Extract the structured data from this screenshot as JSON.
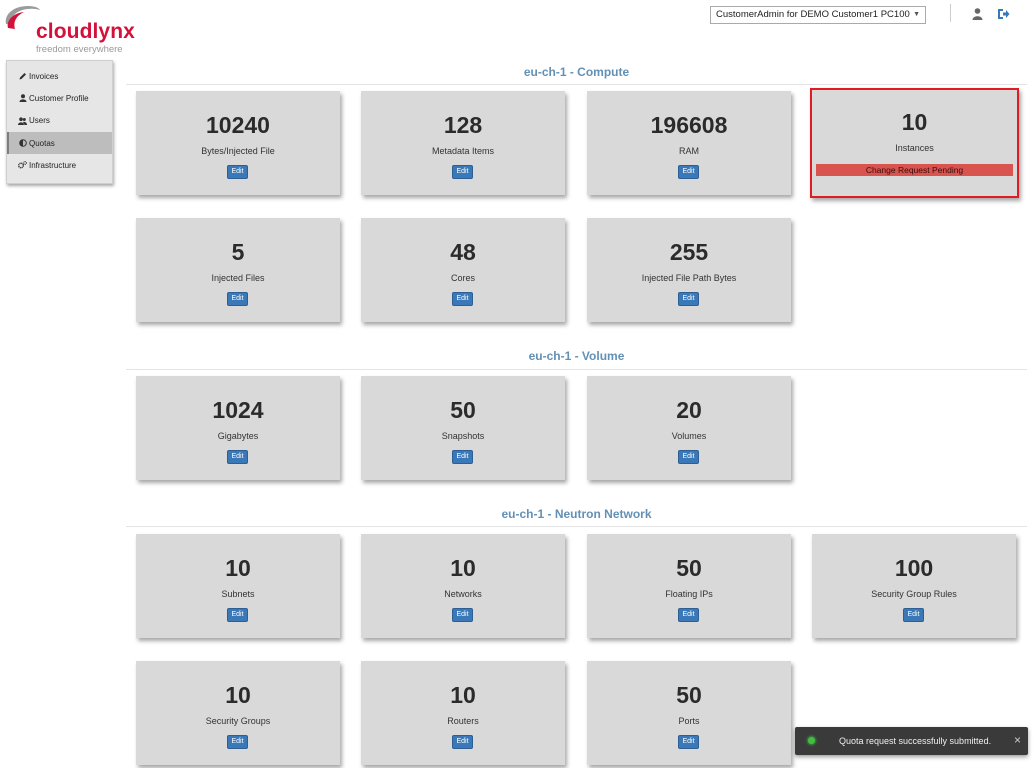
{
  "brand": {
    "name": "cloudlynx",
    "tagline": "freedom everywhere",
    "accent_color": "#d4113a"
  },
  "header": {
    "account_select": "CustomerAdmin for DEMO Customer1 PC100",
    "user_icon": "user-icon",
    "logout_icon": "sign-out-icon"
  },
  "sidebar": {
    "items": [
      {
        "label": "Invoices",
        "icon": "pencil-icon",
        "active": false
      },
      {
        "label": "Customer Profile",
        "icon": "user-icon",
        "active": false
      },
      {
        "label": "Users",
        "icon": "users-icon",
        "active": false
      },
      {
        "label": "Quotas",
        "icon": "half-circle-icon",
        "active": true
      },
      {
        "label": "Infrastructure",
        "icon": "cogs-icon",
        "active": false
      }
    ]
  },
  "sections": [
    {
      "title": "eu-ch-1 - Compute",
      "cards": [
        {
          "value": "10240",
          "label": "Bytes/Injected File",
          "action": "Edit"
        },
        {
          "value": "128",
          "label": "Metadata Items",
          "action": "Edit"
        },
        {
          "value": "196608",
          "label": "RAM",
          "action": "Edit"
        },
        {
          "value": "10",
          "label": "Instances",
          "status": "Change Request Pending"
        },
        {
          "value": "5",
          "label": "Injected Files",
          "action": "Edit"
        },
        {
          "value": "48",
          "label": "Cores",
          "action": "Edit"
        },
        {
          "value": "255",
          "label": "Injected File Path Bytes",
          "action": "Edit"
        }
      ]
    },
    {
      "title": "eu-ch-1 - Volume",
      "cards": [
        {
          "value": "1024",
          "label": "Gigabytes",
          "action": "Edit"
        },
        {
          "value": "50",
          "label": "Snapshots",
          "action": "Edit"
        },
        {
          "value": "20",
          "label": "Volumes",
          "action": "Edit"
        }
      ]
    },
    {
      "title": "eu-ch-1 - Neutron Network",
      "cards": [
        {
          "value": "10",
          "label": "Subnets",
          "action": "Edit"
        },
        {
          "value": "10",
          "label": "Networks",
          "action": "Edit"
        },
        {
          "value": "50",
          "label": "Floating IPs",
          "action": "Edit"
        },
        {
          "value": "100",
          "label": "Security Group Rules",
          "action": "Edit"
        },
        {
          "value": "10",
          "label": "Security Groups",
          "action": "Edit"
        },
        {
          "value": "10",
          "label": "Routers",
          "action": "Edit"
        },
        {
          "value": "50",
          "label": "Ports",
          "action": "Edit"
        }
      ]
    }
  ],
  "toast": {
    "message": "Quota request successfully submitted.",
    "close": "×",
    "status_color": "#3fbf3f"
  }
}
